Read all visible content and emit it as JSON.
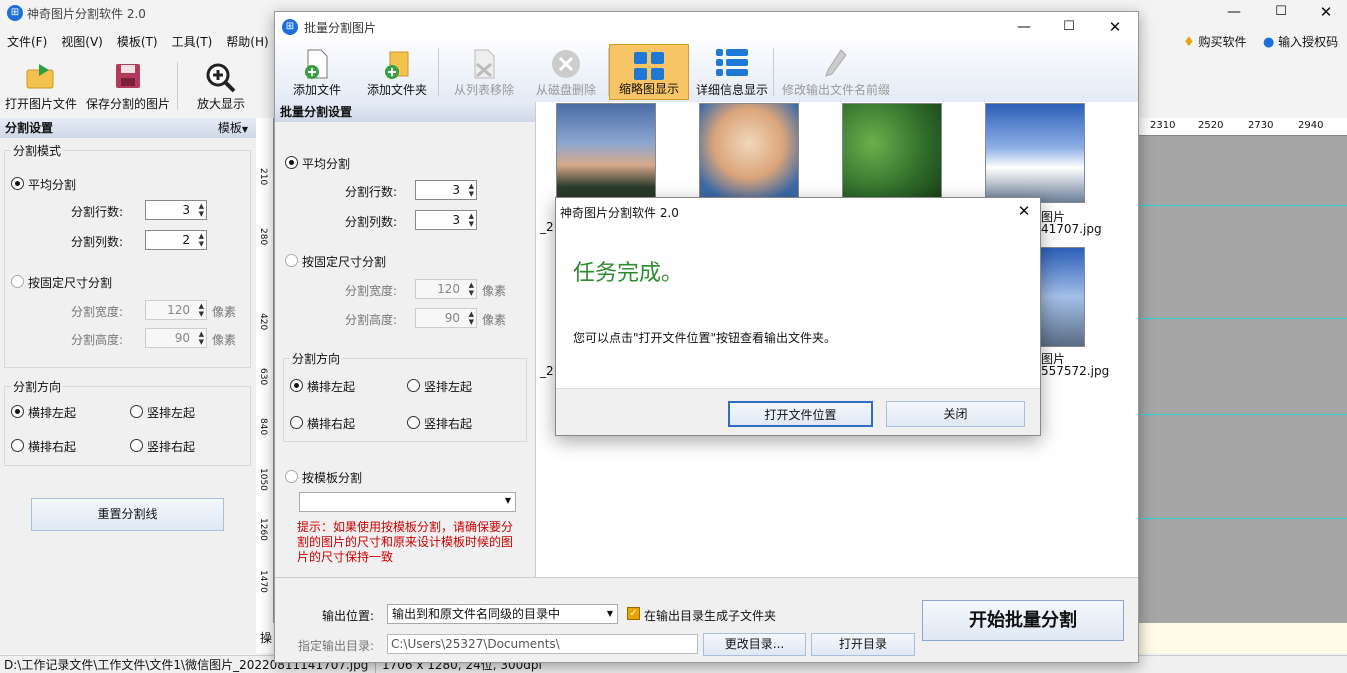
{
  "main": {
    "title": "神奇图片分割软件 2.0",
    "menu": [
      "文件(F)",
      "视图(V)",
      "模板(T)",
      "工具(T)",
      "帮助(H)"
    ],
    "buy_label": "购买软件",
    "license_label": "输入授权码",
    "toolbar": {
      "open_image": "打开图片文件",
      "save_split": "保存分割的图片",
      "zoom_in": "放大显示"
    },
    "panel": {
      "header": "分割设置",
      "template_menu": "模板",
      "mode_group": "分割模式",
      "even_split": "平均分割",
      "rows_label": "分割行数:",
      "rows_value": "3",
      "cols_label": "分割列数:",
      "cols_value": "2",
      "fixed_split": "按固定尺寸分割",
      "width_label": "分割宽度:",
      "width_value": "120",
      "height_label": "分割高度:",
      "height_value": "90",
      "unit": "像素",
      "direction_group": "分割方向",
      "dir_lr": "横排左起",
      "dir_tb_left": "竖排左起",
      "dir_rl": "横排右起",
      "dir_tb_right": "竖排右起",
      "reset_button": "重置分割线"
    },
    "ruler_v_labels": [
      "210",
      "280",
      "420",
      "630",
      "840",
      "1050",
      "1260",
      "1470"
    ],
    "ruler_h_labels": [
      "2310",
      "2520",
      "2730",
      "2940"
    ],
    "status_path": "D:\\工作记录文件\\工作文件\\文件1\\微信图片_20220811141707.jpg",
    "status_info": "1706 x 1280, 24位, 300dpi",
    "status_left_char": "操"
  },
  "batch": {
    "title": "批量分割图片",
    "toolbar": {
      "add_file": "添加文件",
      "add_folder": "添加文件夹",
      "remove_list": "从列表移除",
      "delete_disk": "从磁盘删除",
      "thumb_view": "缩略图显示",
      "detail_view": "详细信息显示",
      "rename_prefix": "修改输出文件名前缀"
    },
    "settings": {
      "header": "批量分割设置",
      "even_split": "平均分割",
      "rows_label": "分割行数:",
      "rows_value": "3",
      "cols_label": "分割列数:",
      "cols_value": "3",
      "fixed_split": "按固定尺寸分割",
      "width_label": "分割宽度:",
      "width_value": "120",
      "height_label": "分割高度:",
      "height_value": "90",
      "unit": "像素",
      "direction_group": "分割方向",
      "dir_lr": "横排左起",
      "dir_tb_left": "竖排左起",
      "dir_rl": "横排右起",
      "dir_tb_right": "竖排右起",
      "template_split": "按模板分割",
      "hint": "提示：如果使用按模板分割，请确保要分割的图片的尺寸和原来设计模板时候的图片的尺寸保持一致"
    },
    "thumbs": [
      {
        "caption_line1": "_2",
        "caption_line2": ""
      },
      {
        "caption_line1": "",
        "caption_line2": ""
      },
      {
        "caption_line1": "",
        "caption_line2": ""
      },
      {
        "caption_line1": "图片",
        "caption_line2": "41707.jpg"
      },
      {
        "caption_line1": "_2",
        "caption_line2": ""
      },
      {
        "caption_line1": "图片",
        "caption_line2": "557572.jpg"
      }
    ],
    "bottom": {
      "output_label": "输出位置:",
      "output_value": "输出到和原文件名同级的目录中",
      "subfolder_label": "在输出目录生成子文件夹",
      "dir_label": "指定输出目录:",
      "dir_value": "C:\\Users\\25327\\Documents\\",
      "change_dir": "更改目录...",
      "open_dir": "打开目录",
      "start_button": "开始批量分割"
    }
  },
  "dialog": {
    "title": "神奇图片分割软件 2.0",
    "heading": "任务完成。",
    "message": "您可以点击\"打开文件位置\"按钮查看输出文件夹。",
    "open_location": "打开文件位置",
    "close": "关闭"
  },
  "colors": {
    "accent_green": "#2e8b2e",
    "hint_red": "#cc0000",
    "app_icon_blue": "#1e6fd9",
    "toolbar_active": "#f7c566"
  }
}
